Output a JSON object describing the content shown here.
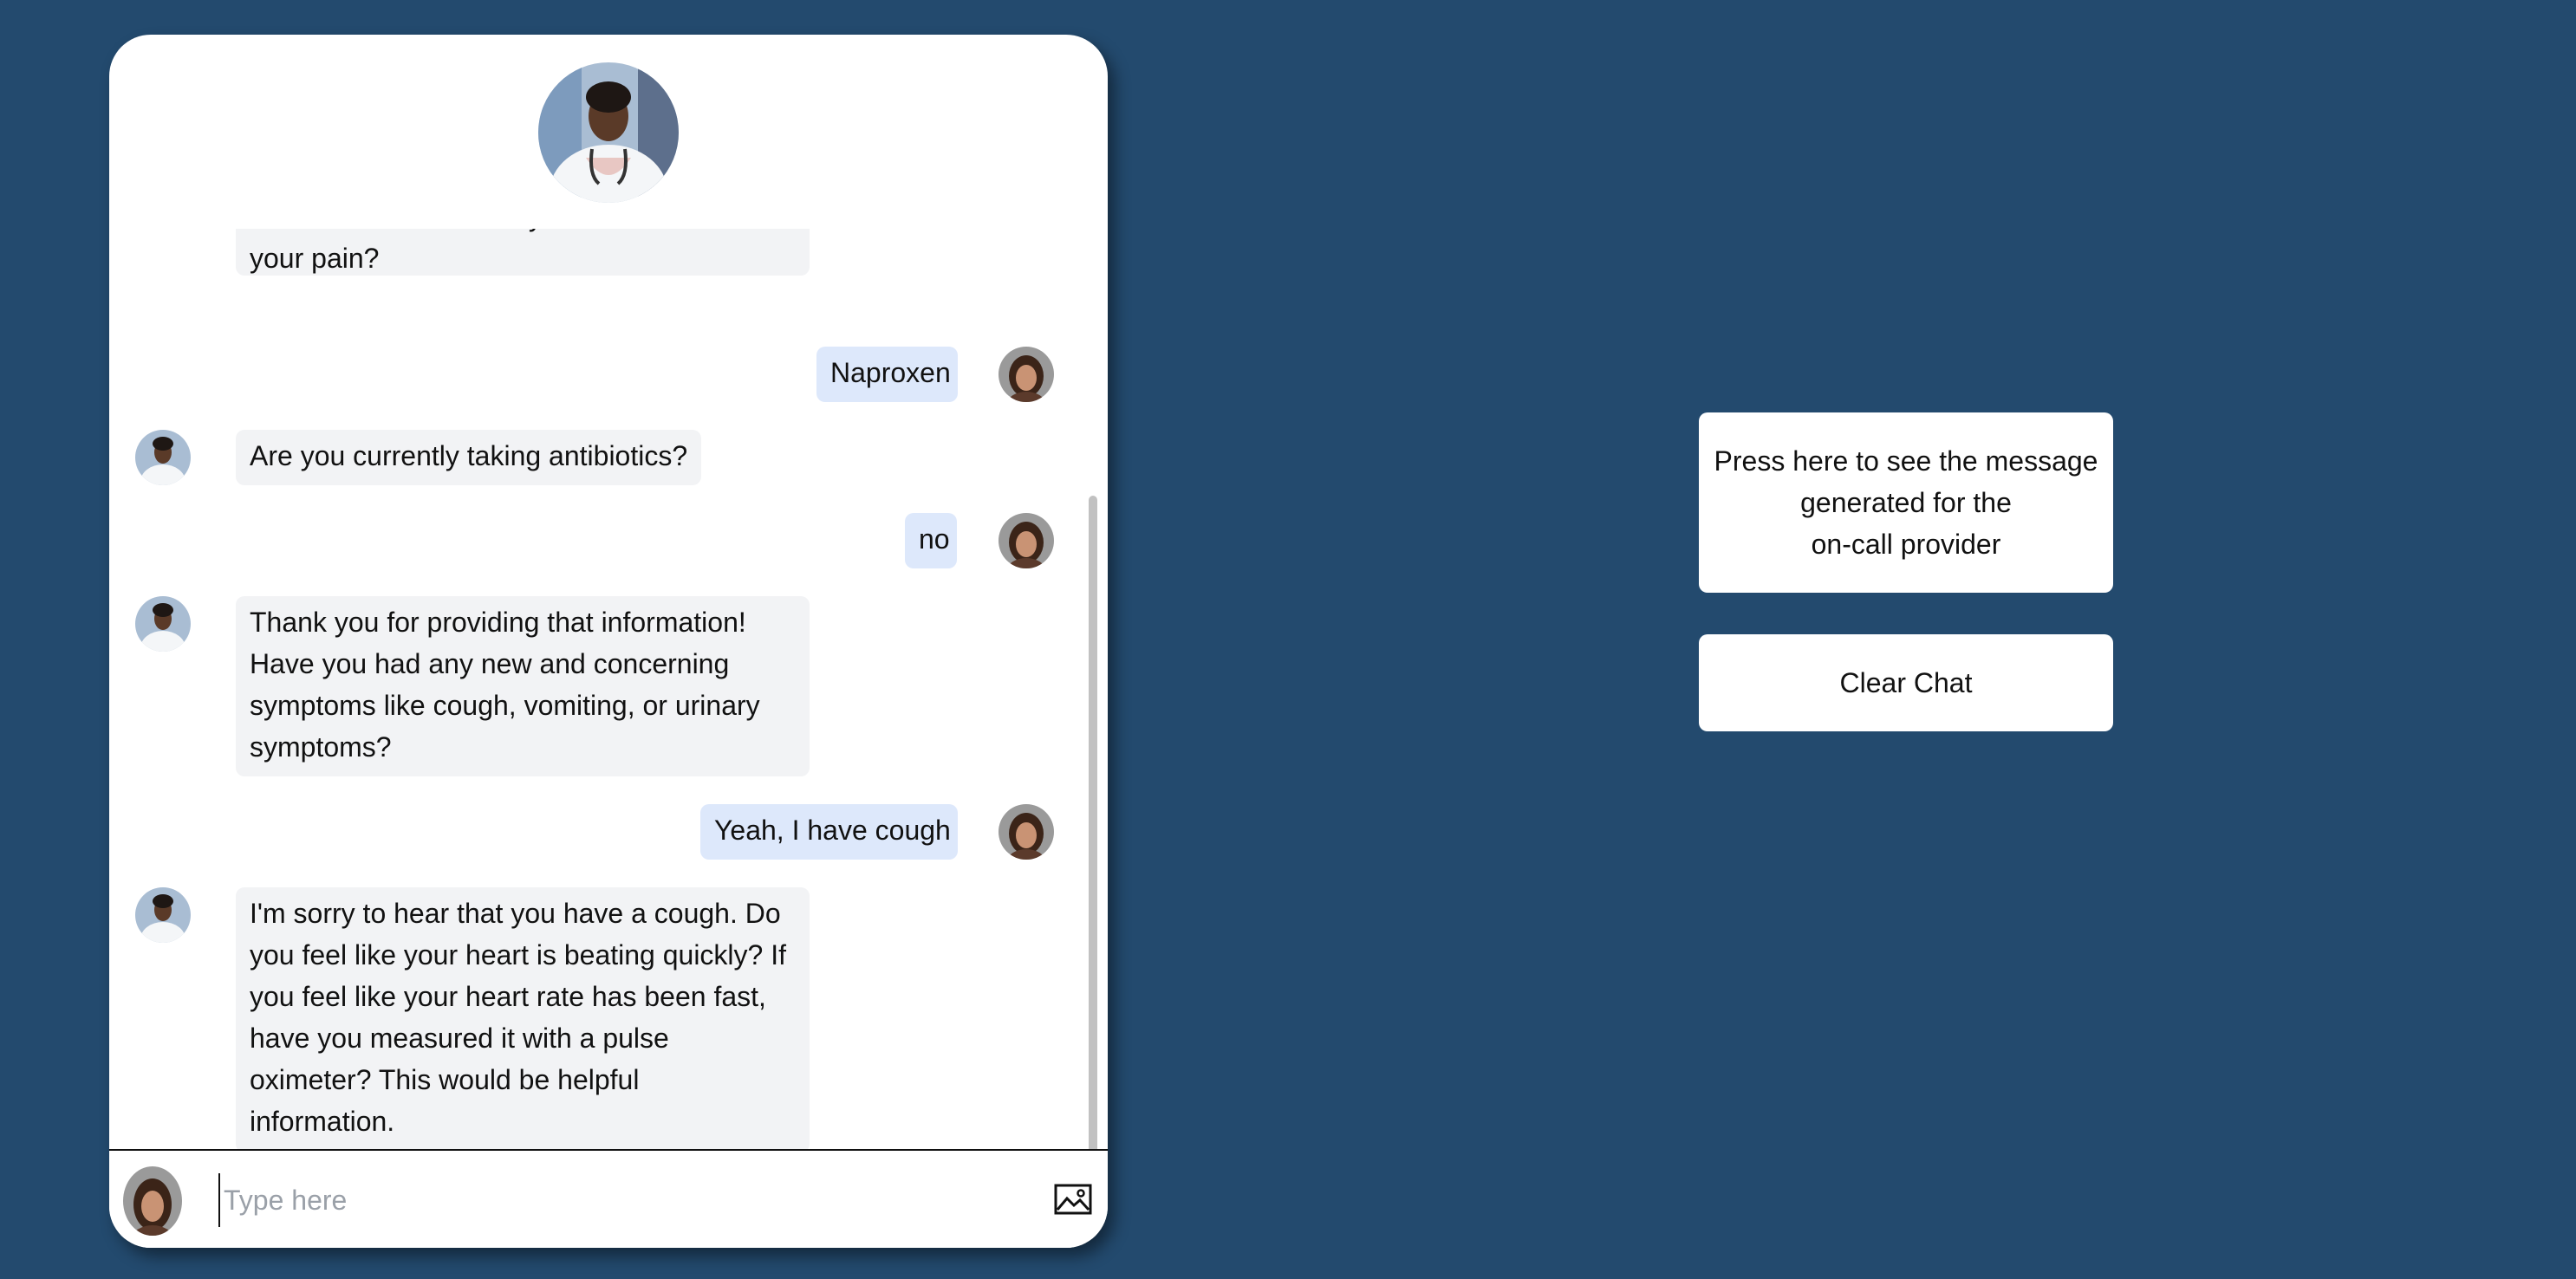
{
  "chat": {
    "messages": [
      {
        "role": "bot",
        "text": "Which medications do you take for\nyour pain?"
      },
      {
        "role": "user",
        "text": "Naproxen"
      },
      {
        "role": "bot",
        "text": "Are you currently taking antibiotics?"
      },
      {
        "role": "user",
        "text": "no"
      },
      {
        "role": "bot",
        "text": "Thank you for providing that information!\nHave you had any new and concerning\nsymptoms like cough, vomiting, or urinary\nsymptoms?"
      },
      {
        "role": "user",
        "text": "Yeah, I have cough"
      },
      {
        "role": "bot",
        "text": "I'm sorry to hear that you have a cough. Do\nyou feel like your heart is beating quickly? If\nyou feel like your heart rate has been fast,\nhave you measured it with a pulse\noximeter? This would be helpful\ninformation."
      }
    ],
    "input": {
      "placeholder": "Type here",
      "value": ""
    },
    "icons": {
      "image_upload": "image-icon"
    }
  },
  "actions": {
    "provider_message_label": "Press here to see the message\ngenerated for the\non-call provider",
    "clear_chat_label": "Clear Chat"
  },
  "colors": {
    "background": "#234a6e",
    "bot_bubble": "#f2f3f5",
    "user_bubble": "#dde8fb"
  }
}
